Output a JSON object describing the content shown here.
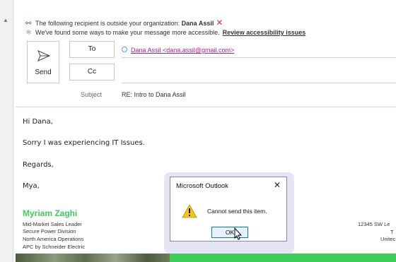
{
  "info": {
    "outside_prefix": "The following recipient is outside your organization:",
    "outside_name": "Dana Assil",
    "accessibility_text": "We've found some ways to make your message more accessible.",
    "accessibility_link": "Review accessibility issues"
  },
  "compose": {
    "send_label": "Send",
    "to_label": "To",
    "cc_label": "Cc",
    "to_recipient": "Dana Assil <dana.assil@gmail.com>",
    "subject_label": "Subject",
    "subject_value": "RE: Intro to Dana Assil"
  },
  "body": {
    "greeting": "Hi Dana,",
    "line1": "Sorry I was experiencing IT Issues.",
    "closing": "Regards,",
    "sender_short": "Mya,"
  },
  "signature": {
    "name": "Myriam Zaghi",
    "lines": [
      "Mid-Market Sales Leader",
      "Secure Power Division",
      "North America Operations",
      "APC by Schneider Electric"
    ],
    "right_lines": [
      "12345 SW Le",
      "T",
      "Unitec"
    ],
    "brand_color": "#3dcd58"
  },
  "dialog": {
    "title": "Microsoft Outlook",
    "message": "Cannot send this item.",
    "ok_label": "OK"
  }
}
